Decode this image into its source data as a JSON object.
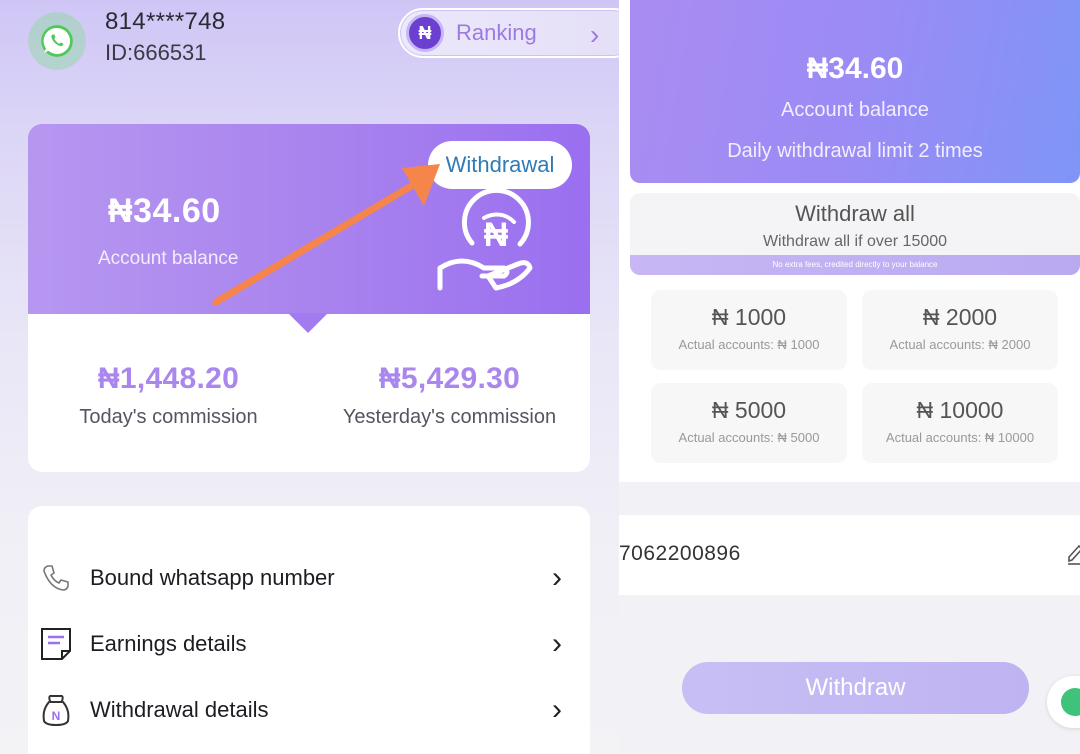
{
  "left": {
    "header": {
      "phone": "814****748",
      "user_id": "ID:666531",
      "ranking_label": "Ranking",
      "ranking_coin": "₦"
    },
    "balance": {
      "amount": "₦34.60",
      "label": "Account balance",
      "withdrawal_button": "Withdrawal",
      "hand_symbol": "₦"
    },
    "commissions": [
      {
        "value": "₦1,448.20",
        "label": "Today's commission"
      },
      {
        "value": "₦5,429.30",
        "label": "Yesterday's commission"
      }
    ],
    "menu": [
      {
        "label": "Bound whatsapp number",
        "icon": "phone-icon"
      },
      {
        "label": "Earnings details",
        "icon": "document-icon"
      },
      {
        "label": "Withdrawal details",
        "icon": "money-bag-icon"
      }
    ]
  },
  "right": {
    "balance": {
      "amount": "₦34.60",
      "label": "Account balance",
      "limit": "Daily withdrawal limit 2 times"
    },
    "withdraw_all": {
      "title": "Withdraw all",
      "subtitle": "Withdraw all if over 15000",
      "note": "No extra fees, credited directly to your balance"
    },
    "amounts": [
      {
        "value": "₦ 1000",
        "sub": "Actual accounts: ₦ 1000"
      },
      {
        "value": "₦ 2000",
        "sub": "Actual accounts: ₦ 2000"
      },
      {
        "value": "₦ 5000",
        "sub": "Actual accounts: ₦ 5000"
      },
      {
        "value": "₦ 10000",
        "sub": "Actual accounts: ₦ 10000"
      }
    ],
    "account_number": "7062200896",
    "withdraw_button": "Withdraw"
  },
  "colors": {
    "accent_purple": "#a987ec",
    "withdrawal_text": "#2f7bb5",
    "arrow_orange": "#f5854a",
    "whatsapp_green": "#4ec95a"
  }
}
